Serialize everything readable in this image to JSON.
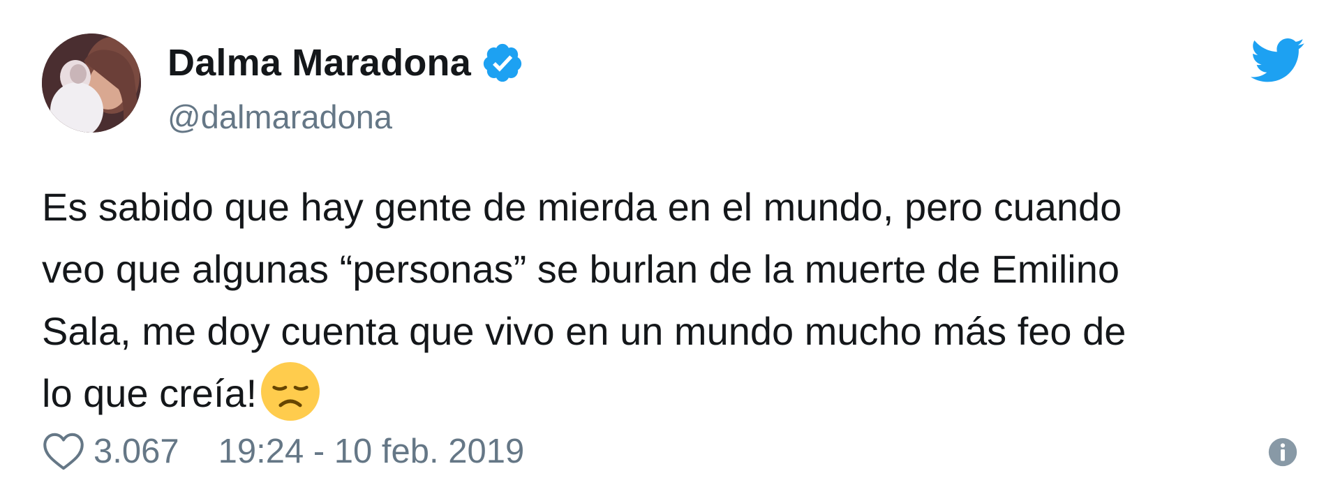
{
  "author": {
    "name": "Dalma Maradona",
    "handle": "@dalmaradona",
    "verified_icon": "verified-badge-icon",
    "avatar": "profile-photo"
  },
  "brand": {
    "icon": "twitter-bird-icon",
    "color": "#1da1f2"
  },
  "tweet": {
    "text": "Es sabido que hay gente de mierda en el mundo, pero cuando\nveo que algunas “personas” se burlan de la muerte de Emilino\nSala, me doy cuenta que vivo en un mundo mucho más feo de\nlo que creía!",
    "emoji": "disappointed-face-emoji"
  },
  "footer": {
    "likes": "3.067",
    "timestamp": "19:24 - 10 feb. 2019",
    "like_icon": "heart-icon",
    "info_icon": "info-icon"
  },
  "colors": {
    "text": "#14171a",
    "secondary": "#657786",
    "accent": "#1da1f2"
  }
}
